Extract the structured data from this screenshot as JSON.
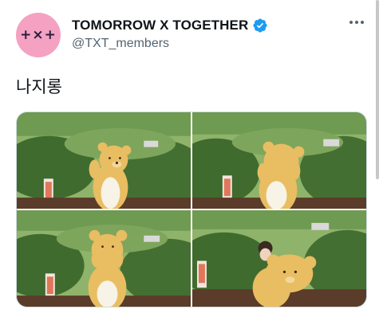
{
  "tweet": {
    "display_name": "TOMORROW X TOGETHER",
    "handle": "@TXT_members",
    "avatar_logo": "+×+",
    "text": "나지롱",
    "verified": true,
    "media": [
      {
        "alt": "photo-1"
      },
      {
        "alt": "photo-2"
      },
      {
        "alt": "photo-3"
      },
      {
        "alt": "photo-4"
      }
    ]
  },
  "colors": {
    "avatar_bg": "#f4a1c2",
    "verified_blue": "#1d9bf0",
    "handle_gray": "#536471",
    "bear_fur": "#e9bd62",
    "foliage": "#4f7a3a"
  },
  "icons": [
    "verified-badge-icon",
    "more-options-icon"
  ]
}
